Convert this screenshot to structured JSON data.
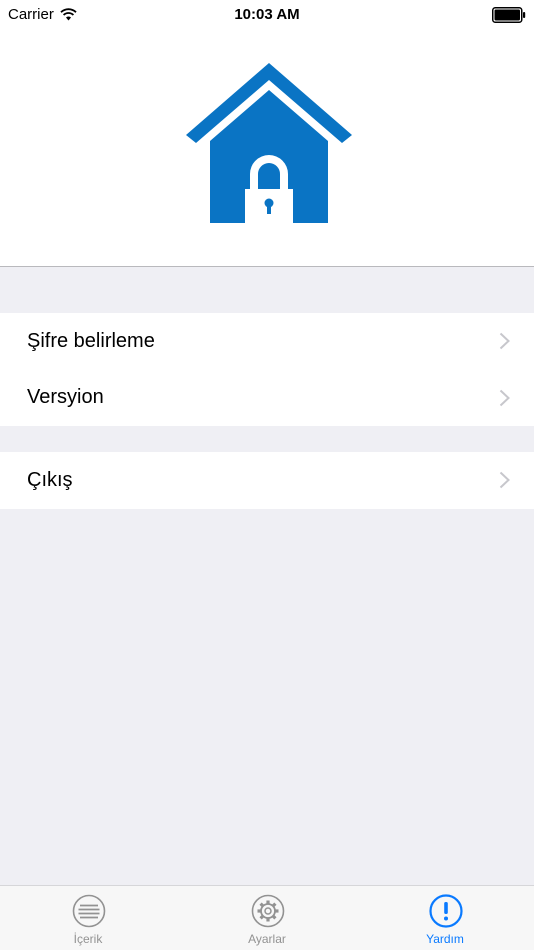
{
  "status_bar": {
    "carrier": "Carrier",
    "time": "10:03 AM",
    "icons": [
      "wifi-icon",
      "battery-icon"
    ]
  },
  "header": {
    "logo": "house-lock-logo",
    "logo_color": "#0a74c4"
  },
  "settings": {
    "group1": [
      {
        "label": "Şifre belirleme",
        "icon": "chevron-right-icon"
      },
      {
        "label": "Versyion",
        "icon": "chevron-right-icon"
      }
    ],
    "group2": [
      {
        "label": "Çıkış",
        "icon": "chevron-right-icon"
      }
    ]
  },
  "tab_bar": {
    "tabs": [
      {
        "label": "İçerik",
        "icon": "list-icon",
        "active": false
      },
      {
        "label": "Ayarlar",
        "icon": "gear-icon",
        "active": false
      },
      {
        "label": "Yardım",
        "icon": "exclamation-icon",
        "active": true
      }
    ],
    "active_color": "#0a7aff",
    "inactive_color": "#929292"
  }
}
